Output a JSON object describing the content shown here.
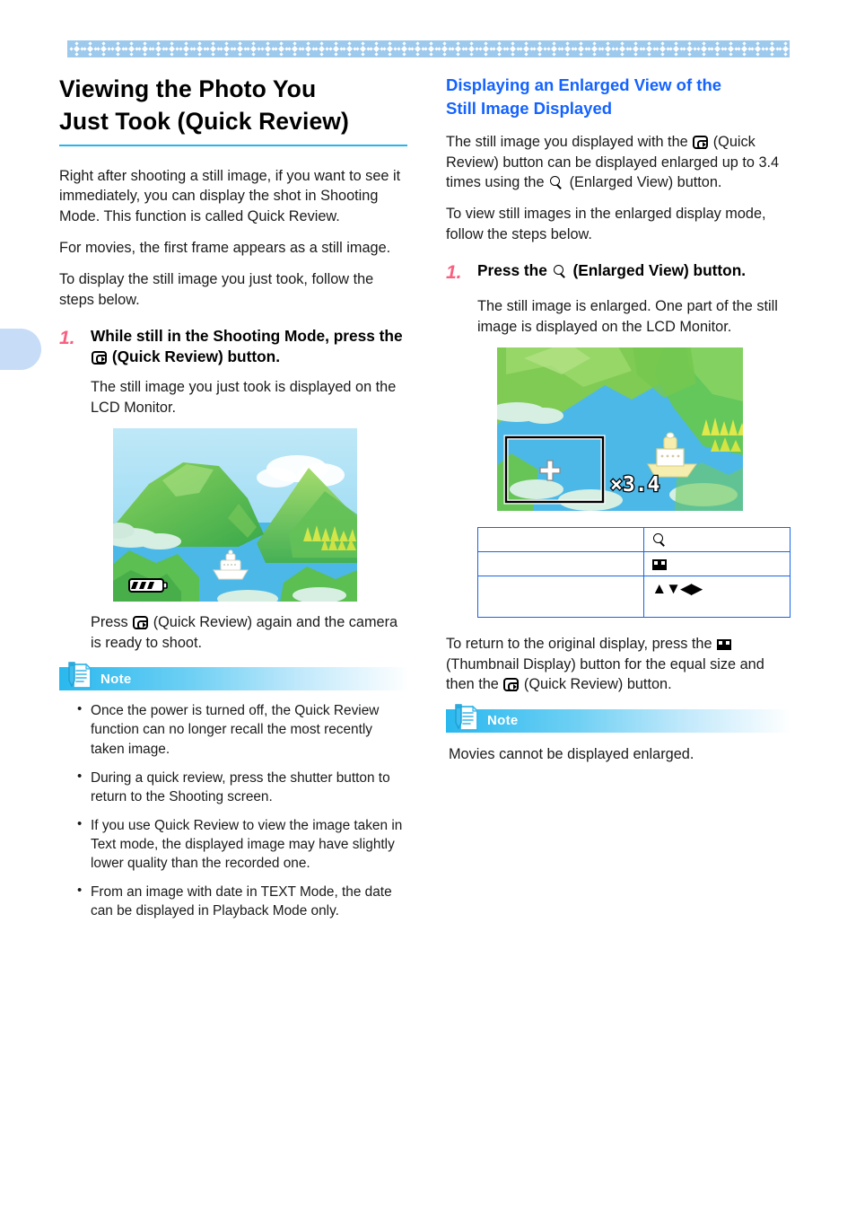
{
  "decor": {
    "band_color": "#9cc9ec",
    "motif_count": 53,
    "tab_color": "#c6dcf7"
  },
  "colors": {
    "title_rule": "#27b4ea",
    "subhead": "#1463ff",
    "step_number": "#f8607f",
    "table_border": "#1565e8",
    "note_gradient_start": "#29b8ee"
  },
  "left": {
    "title_line1": "Viewing the Photo You",
    "title_line2": "Just Took (Quick Review)",
    "intro1": "Right after shooting a still image, if you want to see it immediately, you can display the shot in Shooting Mode. This function is called Quick Review.",
    "intro2": "For movies, the first frame appears as a still image.",
    "intro3": "To display the still image you just took, follow the steps below.",
    "step": {
      "number": "1.",
      "text_before_icon": "While still in the Shooting Mode, press the",
      "icon": "quick-review-icon",
      "text_after_icon": "(Quick Review) button.",
      "body": "The still image you just took is displayed on the LCD Monitor."
    },
    "figure": {
      "name": "lcd-landscape-preview",
      "battery_indicator": "battery-icon"
    },
    "after_figure_before_icon": "Press",
    "after_figure_after_icon": "(Quick Review) again and the camera is ready to shoot.",
    "note": {
      "label": "Note",
      "icon": "note-pen-document-icon",
      "items": [
        "Once the power is turned off, the Quick Review function can no longer recall the most recently taken image.",
        "During a quick review, press the shutter button to return to the Shooting screen.",
        "If you use Quick Review to view the image taken in Text mode, the displayed image may have slightly lower quality than the recorded one.",
        "From an image with date in TEXT Mode, the date can be displayed in Playback Mode only."
      ]
    }
  },
  "right": {
    "subhead_line1": "Displaying an Enlarged View of the",
    "subhead_line2": "Still Image Displayed",
    "intro1_a": "The still image you displayed with the",
    "intro1_b": "(Quick Review) button can be displayed enlarged up to 3.4 times using the",
    "intro1_c": "(Enlarged View) button.",
    "intro2": "To view still images in the enlarged display mode, follow the steps below.",
    "step": {
      "number": "1.",
      "text_before_icon": "Press the",
      "icon": "magnifier-icon",
      "text_after_icon": "(Enlarged View) button.",
      "body": "The still image is enlarged. One part of the still image is displayed on the LCD Monitor."
    },
    "figure": {
      "name": "lcd-enlarged-preview",
      "zoom_label": "×3.4",
      "crosshair": "crosshair-icon",
      "selection_frame": "selection-rectangle"
    },
    "table": {
      "rows": [
        {
          "label": "",
          "icon": "magnifier-icon",
          "icon_text": ""
        },
        {
          "label": "",
          "icon": "thumbnail-display-icon",
          "icon_text": ""
        },
        {
          "label": "",
          "icon": "direction-arrows-icon",
          "icon_text": "▲▼◀▶"
        }
      ]
    },
    "closing_a": "To return to the original display, press the",
    "closing_b": "(Thumbnail Display) button for the equal size and then the",
    "closing_c": "(Quick Review) button.",
    "note": {
      "label": "Note",
      "icon": "note-pen-document-icon",
      "text": "Movies cannot be displayed enlarged."
    }
  }
}
